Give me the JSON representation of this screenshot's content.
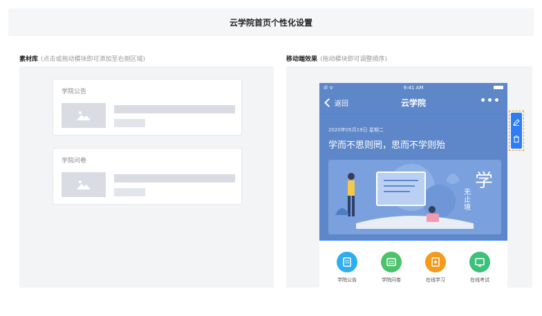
{
  "header": {
    "title": "云学院首页个性化设置"
  },
  "library": {
    "label": "素材库",
    "hint": "(点击或拖动模块即可添加至右侧区域)",
    "cards": [
      {
        "title": "学院公告"
      },
      {
        "title": "学院问卷"
      }
    ]
  },
  "mobile": {
    "label": "移动端效果",
    "hint": "(拖动模块即可调整顺序)",
    "status": {
      "time": "9:41 AM",
      "signal": "ıll ᯤ"
    },
    "nav": {
      "back": "返回",
      "title": "云学院",
      "more": "•••"
    },
    "hero": {
      "date": "2020年05月19日 星期二",
      "motto": "学而不思则罔，思而不学则殆",
      "banner_char": "学",
      "banner_sub": "无止境"
    },
    "toolbar": [
      "edit-icon",
      "delete-icon"
    ],
    "shortcuts": [
      {
        "label": "学院公告",
        "color": "#2eaef0"
      },
      {
        "label": "学院问卷",
        "color": "#4cc26a"
      },
      {
        "label": "在线学习",
        "color": "#f59a1b"
      },
      {
        "label": "在线考试",
        "color": "#3cc07a"
      }
    ]
  }
}
